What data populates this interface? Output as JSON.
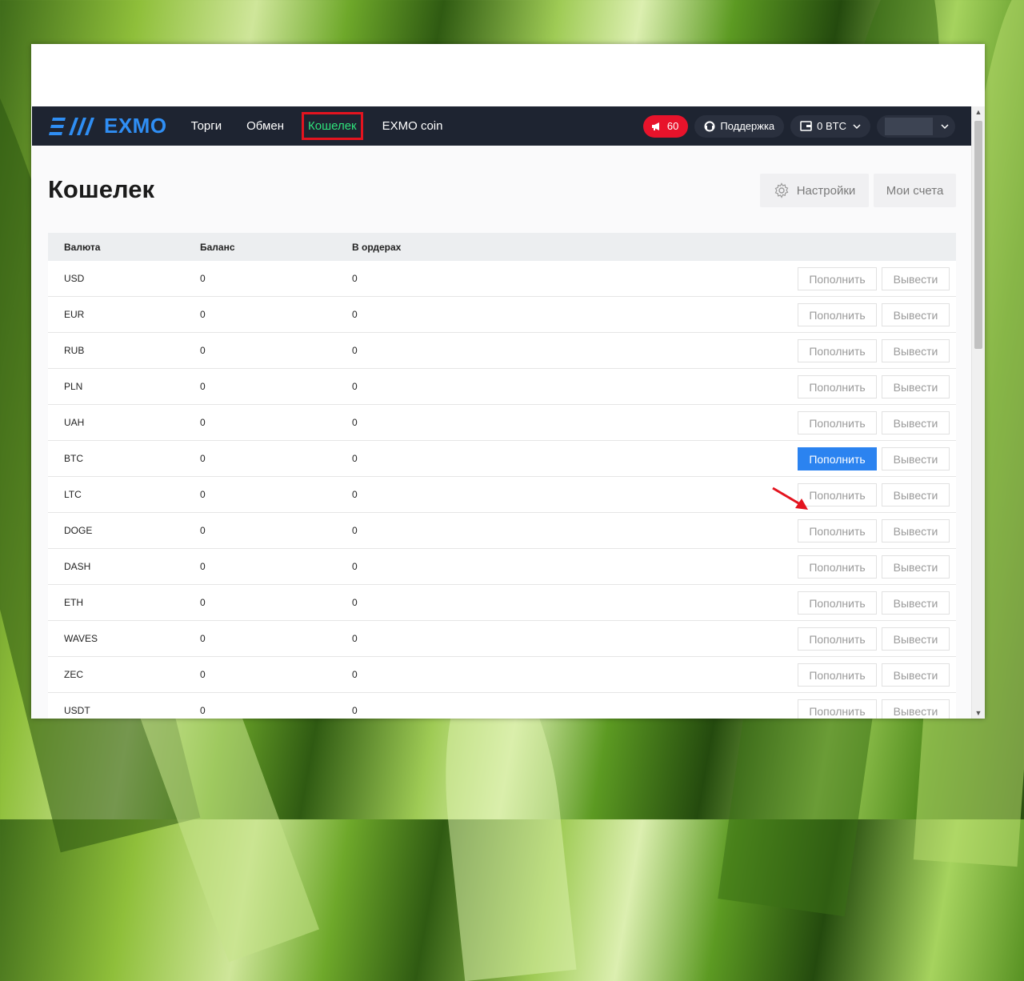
{
  "nav": {
    "logo_text": "EXMO",
    "links": [
      {
        "label": "Торги"
      },
      {
        "label": "Обмен"
      },
      {
        "label": "Кошелек"
      },
      {
        "label": "EXMO coin"
      }
    ],
    "notifications_count": "60",
    "support_label": "Поддержка",
    "balance_label": "0 BTC"
  },
  "page": {
    "title": "Кошелек",
    "settings_label": "Настройки",
    "accounts_label": "Мои счета"
  },
  "table": {
    "headers": [
      "Валюта",
      "Баланс",
      "В ордерах"
    ],
    "deposit_label": "Пополнить",
    "withdraw_label": "Вывести",
    "rows": [
      {
        "currency": "USD",
        "balance": "0",
        "in_orders": "0"
      },
      {
        "currency": "EUR",
        "balance": "0",
        "in_orders": "0"
      },
      {
        "currency": "RUB",
        "balance": "0",
        "in_orders": "0"
      },
      {
        "currency": "PLN",
        "balance": "0",
        "in_orders": "0"
      },
      {
        "currency": "UAH",
        "balance": "0",
        "in_orders": "0"
      },
      {
        "currency": "BTC",
        "balance": "0",
        "in_orders": "0",
        "highlighted": true
      },
      {
        "currency": "LTC",
        "balance": "0",
        "in_orders": "0"
      },
      {
        "currency": "DOGE",
        "balance": "0",
        "in_orders": "0"
      },
      {
        "currency": "DASH",
        "balance": "0",
        "in_orders": "0"
      },
      {
        "currency": "ETH",
        "balance": "0",
        "in_orders": "0"
      },
      {
        "currency": "WAVES",
        "balance": "0",
        "in_orders": "0"
      },
      {
        "currency": "ZEC",
        "balance": "0",
        "in_orders": "0"
      },
      {
        "currency": "USDT",
        "balance": "0",
        "in_orders": "0"
      }
    ]
  },
  "colors": {
    "nav_bg": "#1e2431",
    "brand_blue": "#2f8ef4",
    "active_green": "#2ee27b",
    "highlight_red": "#e3141f",
    "primary_button": "#2b83f0"
  }
}
